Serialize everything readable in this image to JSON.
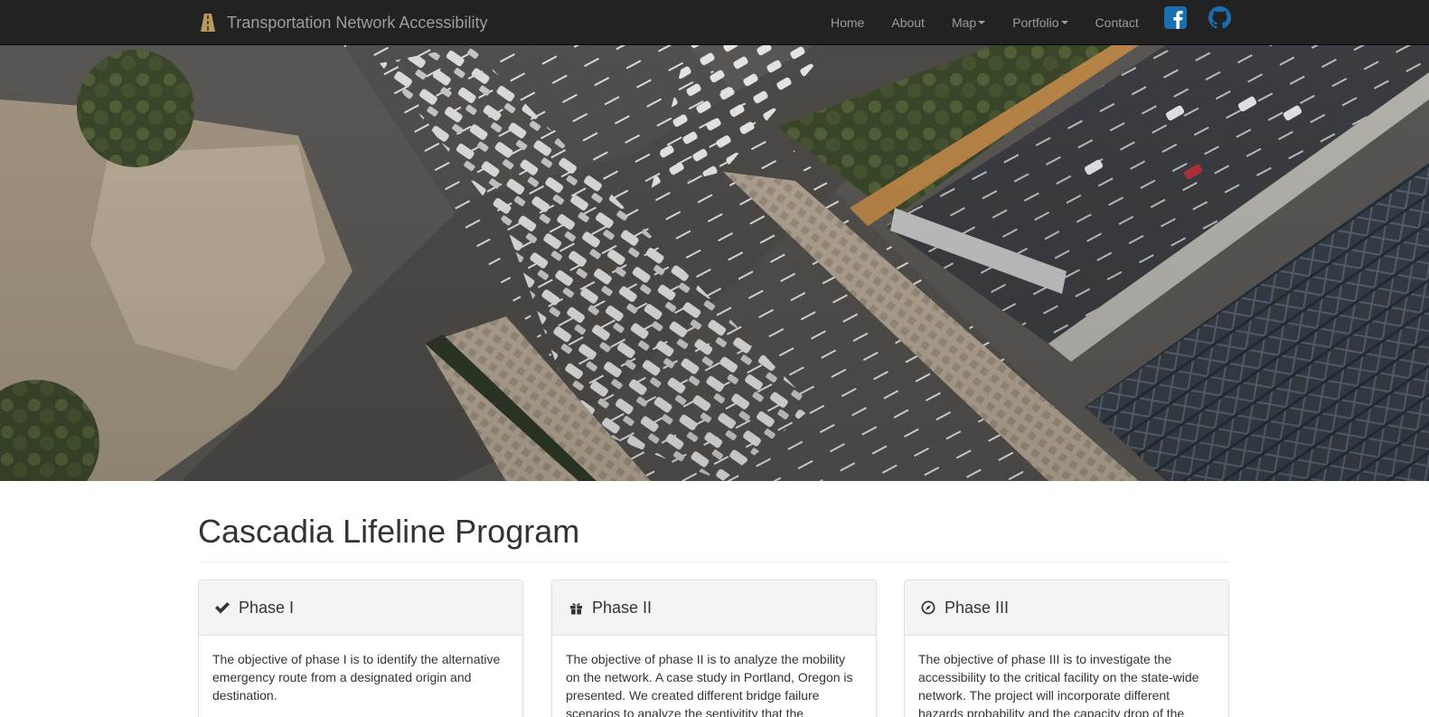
{
  "navbar": {
    "brand": "Transportation Network Accessibility",
    "links": [
      {
        "label": "Home"
      },
      {
        "label": "About"
      },
      {
        "label": "Map",
        "dropdown": true
      },
      {
        "label": "Portfolio",
        "dropdown": true
      },
      {
        "label": "Contact"
      }
    ],
    "social": [
      "facebook-icon",
      "github-icon"
    ]
  },
  "carousel": {
    "slides": 4,
    "active_slide": 1
  },
  "main": {
    "title": "Cascadia Lifeline Program",
    "panels": [
      {
        "icon": "checkmark-icon",
        "title": "Phase I",
        "body": "The objective of phase I is to identify the alternative emergency route from a designated origin and destination."
      },
      {
        "icon": "gift-icon",
        "title": "Phase II",
        "body": "The objective of phase II is to analyze the mobility on the network. A case study in Portland, Oregon is presented. We created different bridge failure scenarios to analyze the sentivitity that the"
      },
      {
        "icon": "compass-icon",
        "title": "Phase III",
        "body": "The objective of phase III is to investigate the accessibility to the critical facility on the state-wide network. The project will incorporate different hazards probability and the capacity drop of the"
      }
    ]
  },
  "colors": {
    "navbar_bg": "#222222",
    "nav_text": "#9d9d9d",
    "social_icon": "#1a6fb0",
    "panel_heading_bg": "#f5f4f2"
  }
}
